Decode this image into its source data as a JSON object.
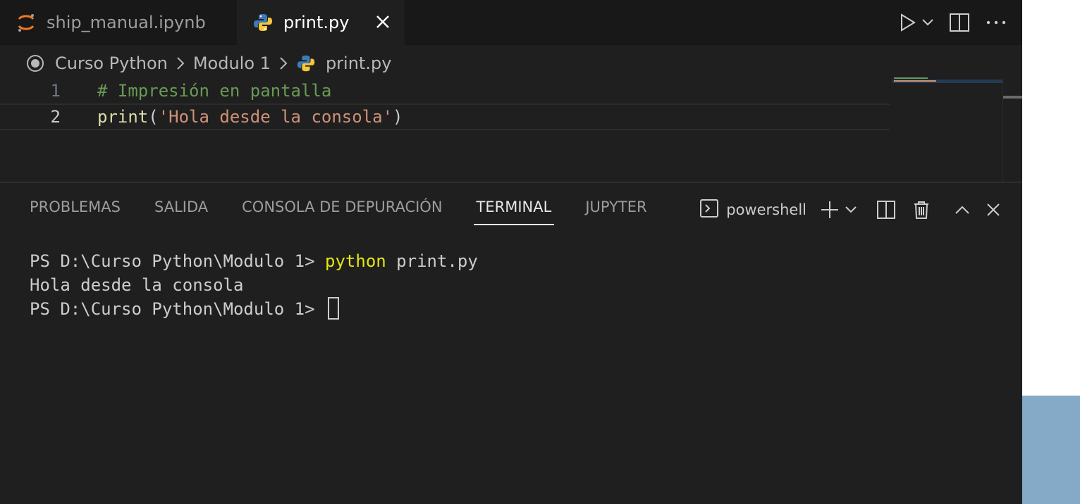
{
  "tabs": [
    {
      "label": "ship_manual.ipynb",
      "icon": "jupyter-icon",
      "active": false
    },
    {
      "label": "print.py",
      "icon": "python-icon",
      "active": true
    }
  ],
  "breadcrumb": {
    "items": [
      "Curso Python",
      "Modulo 1",
      "print.py"
    ]
  },
  "editor": {
    "lines": [
      {
        "number": "1",
        "comment": "# Impresión en pantalla"
      },
      {
        "number": "2",
        "func": "print",
        "open": "(",
        "string": "'Hola desde la consola'",
        "close": ")"
      }
    ]
  },
  "panel": {
    "tabs": [
      "PROBLEMAS",
      "SALIDA",
      "CONSOLA DE DEPURACIÓN",
      "TERMINAL",
      "JUPYTER"
    ],
    "active_tab": "TERMINAL",
    "terminal_name": "powershell"
  },
  "terminal": {
    "prompt1": "PS D:\\Curso Python\\Modulo 1> ",
    "command": "python",
    "args": " print.py",
    "output": "Hola desde la consola",
    "prompt2": "PS D:\\Curso Python\\Modulo 1> "
  },
  "colors": {
    "editor_bg": "#1f1f1f",
    "tabbar_bg": "#181818",
    "comment": "#6a9955",
    "function": "#dcdcaa",
    "string": "#ce9178",
    "terminal_command": "#e5e510",
    "desktop_blue": "#85aac8"
  }
}
